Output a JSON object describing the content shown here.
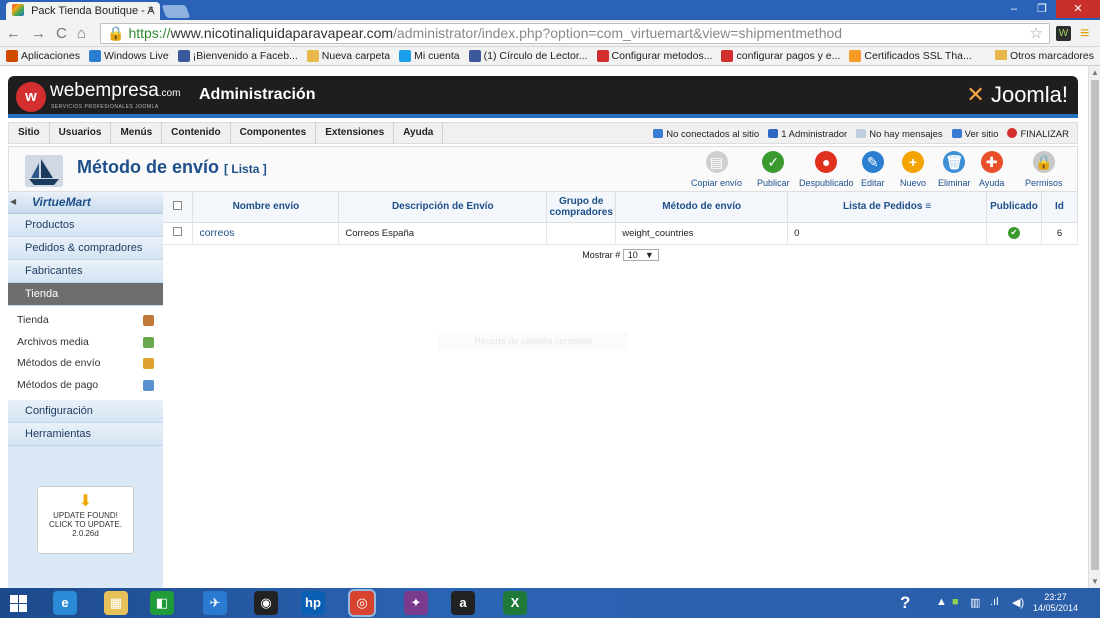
{
  "browser": {
    "tab_title": "Pack Tienda Boutique - A",
    "tab_close": "×",
    "nav": {
      "back": "←",
      "forward": "→",
      "reload": "C",
      "home": "⌂"
    },
    "url_scheme": "https://",
    "url_host": "www.nicotinaliquidaparavapear.com",
    "url_path": "/administrator/index.php?option=com_virtuemart&view=shipmentmethod",
    "star": "☆",
    "menu": "≡",
    "window_controls": {
      "minimize": "–",
      "maximize": "❐",
      "close": "✕"
    },
    "bookmarks": [
      {
        "label": "Aplicaciones",
        "color": "#d04a02"
      },
      {
        "label": "Windows Live",
        "color": "#2b7fd1"
      },
      {
        "label": "¡Bienvenido a Faceb...",
        "color": "#3b5998"
      },
      {
        "label": "Nueva carpeta",
        "color": "#e8b84a"
      },
      {
        "label": "Mi cuenta",
        "color": "#1aa0e8"
      },
      {
        "label": "(1) Círculo de Lector...",
        "color": "#3b5998"
      },
      {
        "label": "Configurar metodos...",
        "color": "#d32f2f"
      },
      {
        "label": "configurar pagos y e...",
        "color": "#d32f2f"
      },
      {
        "label": "Certificados SSL Tha...",
        "color": "#f59a23"
      }
    ],
    "other_bookmarks": "Otros marcadores"
  },
  "header": {
    "brand": "webempresa",
    "brand_suffix": ".com",
    "brand_tagline": "SERVICIOS PROFESIONALES JOOMLA",
    "title": "Administración",
    "joomla": "Joomla!"
  },
  "menu": {
    "items": [
      "Sitio",
      "Usuarios",
      "Menús",
      "Contenido",
      "Componentes",
      "Extensiones",
      "Ayuda"
    ],
    "status": {
      "visitors": "No conectados al sitio",
      "admins": "1 Administrador",
      "messages": "No hay mensajes",
      "view_site": "Ver sitio",
      "logout": "FINALIZAR"
    }
  },
  "toolbar": {
    "title": "Método de envío",
    "subtitle": "[ Lista ]",
    "buttons": [
      {
        "label": "Copiar envío",
        "color": "#cfcfcf",
        "glyph": "▤"
      },
      {
        "label": "Publicar",
        "color": "#3a9a2e",
        "glyph": "✓"
      },
      {
        "label": "Despublicado",
        "color": "#e0301e",
        "glyph": "●"
      },
      {
        "label": "Editar",
        "color": "#2b7fd1",
        "glyph": "✎"
      },
      {
        "label": "Nuevo",
        "color": "#f4a300",
        "glyph": "+"
      },
      {
        "label": "Eliminar",
        "color": "#3d8fd6",
        "glyph": "🗑"
      },
      {
        "label": "Ayuda",
        "color": "#e8502a",
        "glyph": "✚"
      },
      {
        "label": "Permisos",
        "color": "#c8c8c8",
        "glyph": "🔒"
      }
    ]
  },
  "sidebar": {
    "logo": "VirtueMart",
    "items": [
      "Productos",
      "Pedidos & compradores",
      "Fabricantes",
      "Tienda"
    ],
    "sub_items": [
      {
        "label": "Tienda",
        "color": "#c07a3a"
      },
      {
        "label": "Archivos media",
        "color": "#6aa84f"
      },
      {
        "label": "Métodos de envío",
        "color": "#e0a030"
      },
      {
        "label": "Métodos de pago",
        "color": "#5a8fd0"
      }
    ],
    "bottom_items": [
      "Configuración",
      "Herramientas"
    ],
    "update_text": [
      "UPDATE FOUND!",
      "CLICK TO UPDATE.",
      "2.0.26d"
    ]
  },
  "table": {
    "columns": [
      "Nombre envío",
      "Descripción de Envío",
      "Grupo de compradores",
      "Método de envío",
      "Lista de Pedidos",
      "Publicado",
      "Id"
    ],
    "rows": [
      {
        "name": "correos",
        "description": "Correos España",
        "group": "",
        "method": "weight_countries",
        "order": "0",
        "published": "✔",
        "id": "6"
      }
    ],
    "pager_label": "Mostrar #",
    "pager_value": "10",
    "ghost_text": "Recorte de pantalla completa"
  },
  "taskbar": {
    "time": "23:27",
    "date": "14/05/2014",
    "apps": [
      {
        "glyph": "e",
        "color": "#2b8ad6"
      },
      {
        "glyph": "▦",
        "color": "#e7c15a"
      },
      {
        "glyph": "◧",
        "color": "#1f9b3a"
      },
      {
        "glyph": "✈",
        "color": "#2a7bd0"
      },
      {
        "glyph": "◉",
        "color": "#222"
      },
      {
        "glyph": "hp",
        "color": "#0a5fb4"
      },
      {
        "glyph": "◎",
        "color": "#d8432f"
      },
      {
        "glyph": "✦",
        "color": "#7a3b8c"
      },
      {
        "glyph": "a",
        "color": "#222"
      },
      {
        "glyph": "X",
        "color": "#1f7a3a"
      }
    ]
  }
}
